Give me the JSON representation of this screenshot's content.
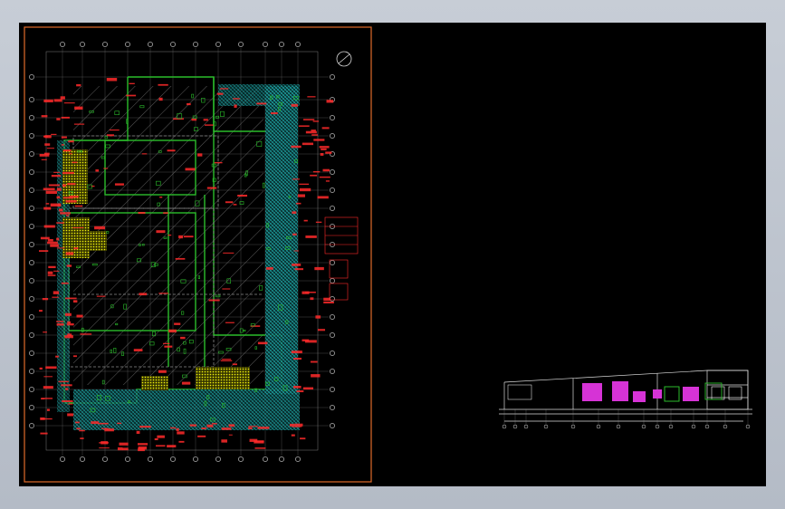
{
  "app": {
    "title": ""
  },
  "colors": {
    "background": "#000000",
    "sheet_border": "#e06a2a",
    "grid": "#ffffff",
    "wall": "#2bbd2b",
    "duct": "#27d3d3",
    "annotation": "#ff2a2a",
    "fixture": "#f2f20d",
    "highlight": "#d633d6"
  },
  "icons": {
    "north_arrow": "north-arrow-icon"
  }
}
